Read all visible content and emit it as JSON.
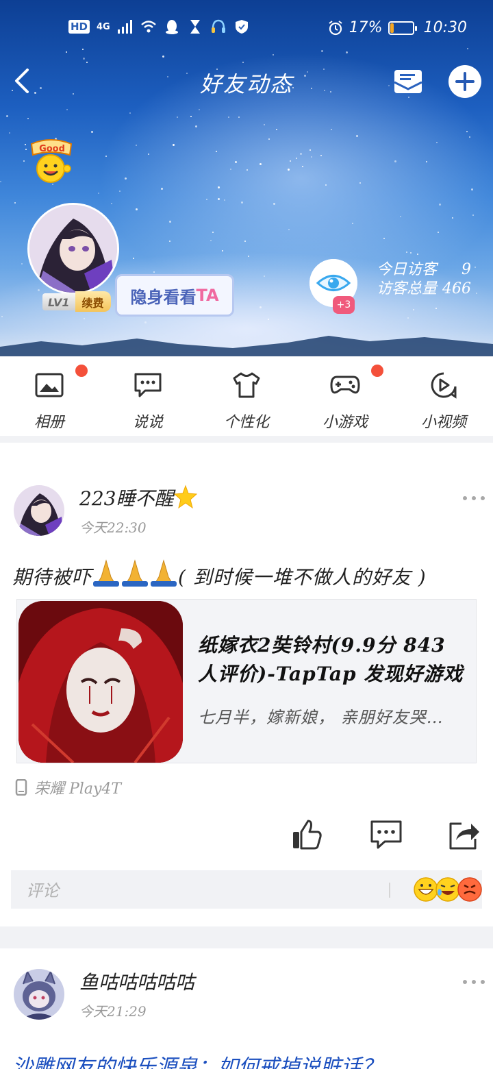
{
  "status_bar": {
    "left_labels": [
      "HD",
      "4G"
    ],
    "battery_text": "17%",
    "battery_level": 0.17,
    "time": "10:30"
  },
  "nav": {
    "title": "好友动态",
    "back_icon": "chevron-left-icon",
    "mail_icon": "envelope-icon",
    "add_icon": "plus-circle-icon"
  },
  "profile": {
    "sticker_text": "Good",
    "level": "LV1",
    "renew_label": "续费",
    "stealth_label_prefix": "隐身看看",
    "stealth_label_suffix": "TA",
    "visitor_badge": "+3",
    "today_visitors_label": "今日访客",
    "today_visitors": "9",
    "total_visitors_label": "访客总量",
    "total_visitors": "466"
  },
  "tabs": [
    {
      "label": "相册",
      "icon": "photo-album-icon",
      "red_dot": true
    },
    {
      "label": "说说",
      "icon": "chat-bubble-icon",
      "red_dot": false
    },
    {
      "label": "个性化",
      "icon": "tshirt-icon",
      "red_dot": true
    },
    {
      "label": "小游戏",
      "icon": "gamepad-icon",
      "red_dot": false
    },
    {
      "label": "小视频",
      "icon": "play-circle-icon",
      "red_dot": false
    }
  ],
  "post1": {
    "author": "223睡不醒",
    "time": "今天22:30",
    "text_before": "期待被吓",
    "text_after": "( 到时候一堆不做人的好友 )",
    "share_title": "纸嫁衣2奘铃村(9.9分 843 人评价)-TapTap 发现好游戏",
    "share_desc": "七月半，嫁新娘， 亲朋好友哭…",
    "device": "荣耀 Play4T",
    "comment_placeholder": "评论"
  },
  "post2": {
    "author": "鱼咕咕咕咕咕",
    "time": "今天21:29",
    "text": "沙雕网友的快乐源泉：如何戒掉说脏话？"
  },
  "colors": {
    "accent_red": "#f4503a",
    "link_blue": "#1b4fbf",
    "separator": "#f1f2f5"
  }
}
